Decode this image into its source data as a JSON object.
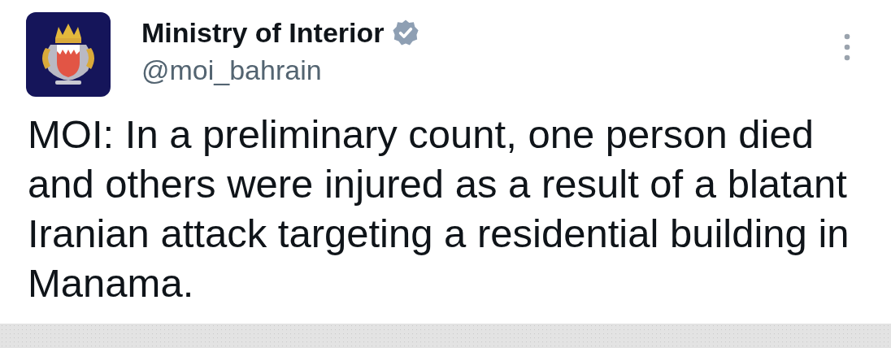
{
  "account": {
    "name": "Ministry of Interior",
    "verified": true,
    "handle": "@moi_bahrain"
  },
  "post": {
    "text": "MOI: In a preliminary count, one person died and others were injured as a result of a blatant Iranian attack targeting a residential building in Manama."
  }
}
